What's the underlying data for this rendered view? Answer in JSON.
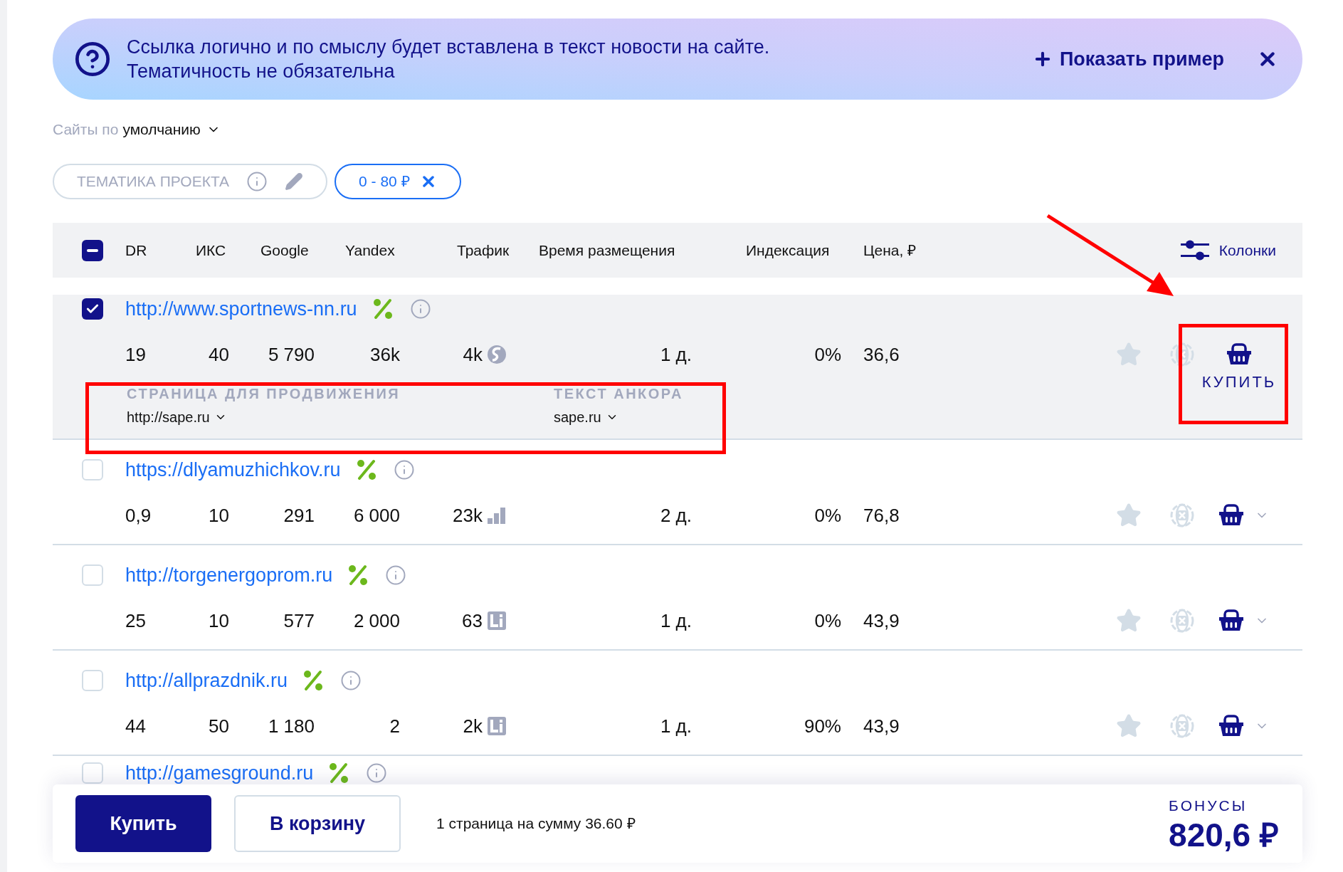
{
  "notice": {
    "lines": [
      "Ссылка логично и по смыслу будет вставлена в текст новости на сайте.",
      "Тематичность не обязательна"
    ],
    "action": "Показать пример"
  },
  "site_set": {
    "label": "Сайты по",
    "value": "умолчанию"
  },
  "filters": [
    {
      "kind": "topic",
      "label": "ТЕМАТИКА ПРОЕКТА",
      "selected": false
    },
    {
      "kind": "price",
      "label": "0 - 80 ₽",
      "selected": true
    }
  ],
  "table": {
    "indeterminate": true,
    "columns": [
      "DR",
      "ИКС",
      "Google",
      "Yandex",
      "Трафик",
      "Время размещения",
      "Индексация",
      "Цена, ₽"
    ],
    "columns_button": "Колонки",
    "rows": [
      {
        "url": "http://www.sportnews-nn.ru",
        "checked": true,
        "metrics": [
          "19",
          "40",
          "5 790",
          "36k",
          "4k",
          "1 д.",
          "0%",
          "36,6"
        ],
        "traffic_icon": {
          "kind": "s-circle"
        },
        "buy_label": "КУПИТЬ",
        "buy_highlighted": true,
        "details": {
          "highlighted": true,
          "page_label": "СТРАНИЦА ДЛЯ ПРОДВИЖЕНИЯ",
          "page_value": "http://sape.ru",
          "anchor_label": "ТЕКСТ АНКОРА",
          "anchor_value": "sape.ru"
        }
      },
      {
        "url": "https://dlyamuzhichkov.ru",
        "checked": false,
        "metrics": [
          "0,9",
          "10",
          "291",
          "6 000",
          "23k",
          "2 д.",
          "0%",
          "76,8"
        ],
        "traffic_icon": {
          "kind": "bars"
        }
      },
      {
        "url": "http://torgenergoprom.ru",
        "checked": false,
        "metrics": [
          "25",
          "10",
          "577",
          "2 000",
          "63",
          "1 д.",
          "0%",
          "43,9"
        ],
        "traffic_icon": {
          "kind": "li"
        }
      },
      {
        "url": "http://allprazdnik.ru",
        "checked": false,
        "metrics": [
          "44",
          "50",
          "1 180",
          "2",
          "2k",
          "1 д.",
          "90%",
          "43,9"
        ],
        "traffic_icon": {
          "kind": "li"
        }
      },
      {
        "url": "http://gamesground.ru",
        "checked": false
      }
    ]
  },
  "footer": {
    "buy": "Купить",
    "cart": "В корзину",
    "summary": "1 страница на сумму 36.60 ₽",
    "bonus_label": "БОНУСЫ",
    "bonus": "820,6 ₽"
  }
}
